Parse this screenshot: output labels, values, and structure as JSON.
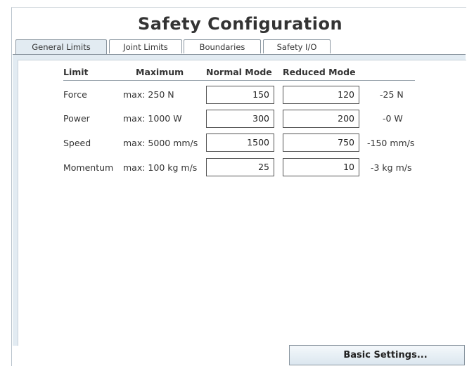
{
  "window": {
    "title": "Safety Configuration"
  },
  "tabs": [
    {
      "label": "General Limits",
      "active": true
    },
    {
      "label": "Joint Limits",
      "active": false
    },
    {
      "label": "Boundaries",
      "active": false
    },
    {
      "label": "Safety I/O",
      "active": false
    }
  ],
  "table": {
    "headers": {
      "limit": "Limit",
      "maximum": "Maximum",
      "normal": "Normal Mode",
      "reduced": "Reduced Mode"
    },
    "rows": [
      {
        "limit": "Force",
        "maximum": "max: 250 N",
        "normal": "150",
        "reduced": "120",
        "delta": "-25 N"
      },
      {
        "limit": "Power",
        "maximum": "max: 1000 W",
        "normal": "300",
        "reduced": "200",
        "delta": "-0 W"
      },
      {
        "limit": "Speed",
        "maximum": "max: 5000 mm/s",
        "normal": "1500",
        "reduced": "750",
        "delta": "-150 mm/s"
      },
      {
        "limit": "Momentum",
        "maximum": "max: 100 kg m/s",
        "normal": "25",
        "reduced": "10",
        "delta": "-3 kg m/s"
      }
    ]
  },
  "footer": {
    "basic_settings_label": "Basic Settings..."
  },
  "colors": {
    "panel": "#e2ebf2",
    "border": "#8a96a0"
  }
}
